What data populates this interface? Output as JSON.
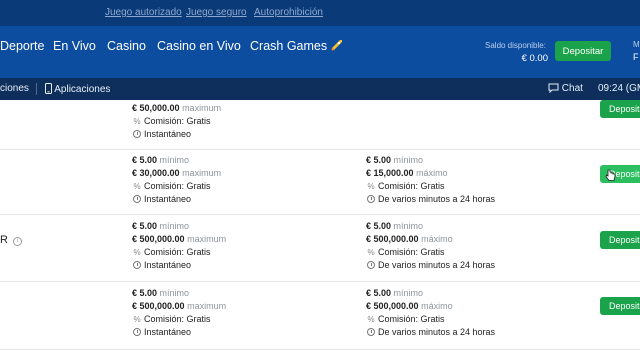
{
  "topbar": {
    "links": [
      "Juego autorizado",
      "Juego seguro",
      "Autoprohibición"
    ]
  },
  "nav": {
    "items": [
      "Deporte",
      "En Vivo",
      "Casino",
      "Casino en Vivo",
      "Crash Games"
    ],
    "saldo_label": "Saldo disponible:",
    "saldo_value": "€ 0.00",
    "depositar_label": "Depositar",
    "edge_top": "M",
    "edge_bottom": "F"
  },
  "subbar": {
    "left_item": "ciones",
    "apps_label": "Aplicaciones",
    "chat_label": "Chat",
    "time": "09:24 (GM"
  },
  "rows": [
    {
      "col1": {
        "max_amount": "€ 50,000.00",
        "max_label": "maximum",
        "fee": "Comisión: Gratis",
        "time": "Instantáneo"
      },
      "button": "Deposita"
    },
    {
      "col1": {
        "min_amount": "€ 5.00",
        "min_label": "mínimo",
        "max_amount": "€ 30,000.00",
        "max_label": "maximum",
        "fee": "Comisión: Gratis",
        "time": "Instantáneo"
      },
      "col2": {
        "min_amount": "€ 5.00",
        "min_label": "mínimo",
        "max_amount": "€ 15,000.00",
        "max_label": "máximo",
        "fee": "Comisión: Gratis",
        "time": "De varios minutos a 24 horas"
      },
      "button": "Deposita"
    },
    {
      "left_fragment": "R",
      "col1": {
        "min_amount": "€ 5.00",
        "min_label": "mínimo",
        "max_amount": "€ 500,000.00",
        "max_label": "maximum",
        "fee": "Comisión: Gratis",
        "time": "Instantáneo"
      },
      "col2": {
        "min_amount": "€ 5.00",
        "min_label": "mínimo",
        "max_amount": "€ 500,000.00",
        "max_label": "máximo",
        "fee": "Comisión: Gratis",
        "time": "De varios minutos a 24 horas"
      },
      "button": "Deposita"
    },
    {
      "col1": {
        "min_amount": "€ 5.00",
        "min_label": "mínimo",
        "max_amount": "€ 500,000.00",
        "max_label": "maximum",
        "fee": "Comisión: Gratis",
        "time": "Instantáneo"
      },
      "col2": {
        "min_amount": "€ 5.00",
        "min_label": "mínimo",
        "max_amount": "€ 500,000.00",
        "max_label": "máximo",
        "fee": "Comisión: Gratis",
        "time": "De varios minutos a 24 horas"
      },
      "button": "Deposita"
    }
  ],
  "colors": {
    "header_dark": "#0a3a78",
    "nav": "#0c4da0",
    "subbar": "#0e2f5c",
    "accent_green": "#1aa34a"
  }
}
